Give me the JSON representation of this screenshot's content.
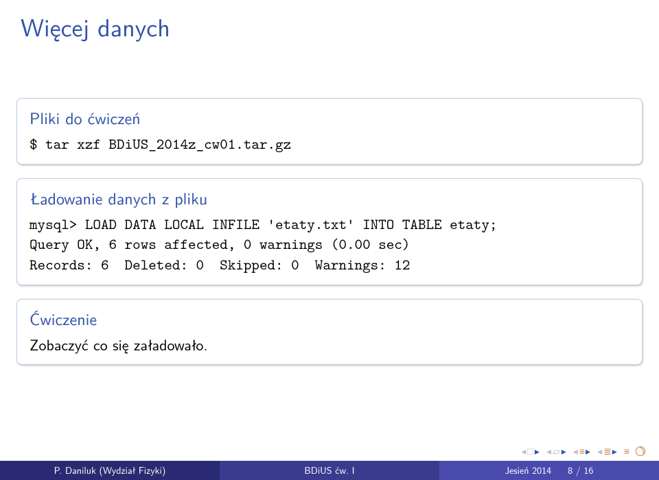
{
  "title": "Więcej danych",
  "blocks": {
    "b1": {
      "title": "Pliki do ćwiczeń",
      "body": "$ tar xzf BDiUS_2014z_cw01.tar.gz"
    },
    "b2": {
      "title": "Ładowanie danych z pliku",
      "body": "mysql> LOAD DATA LOCAL INFILE 'etaty.txt' INTO TABLE etaty;\nQuery OK, 6 rows affected, 0 warnings (0.00 sec)\nRecords: 6  Deleted: 0  Skipped: 0  Warnings: 12"
    },
    "b3": {
      "title": "Ćwiczenie",
      "body": "Zobaczyć co się załadowało."
    }
  },
  "footer": {
    "author": "P. Daniluk (Wydział Fizyki)",
    "course": "BDiUS ćw. I",
    "term": "Jesień 2014",
    "page": "8 / 16"
  }
}
